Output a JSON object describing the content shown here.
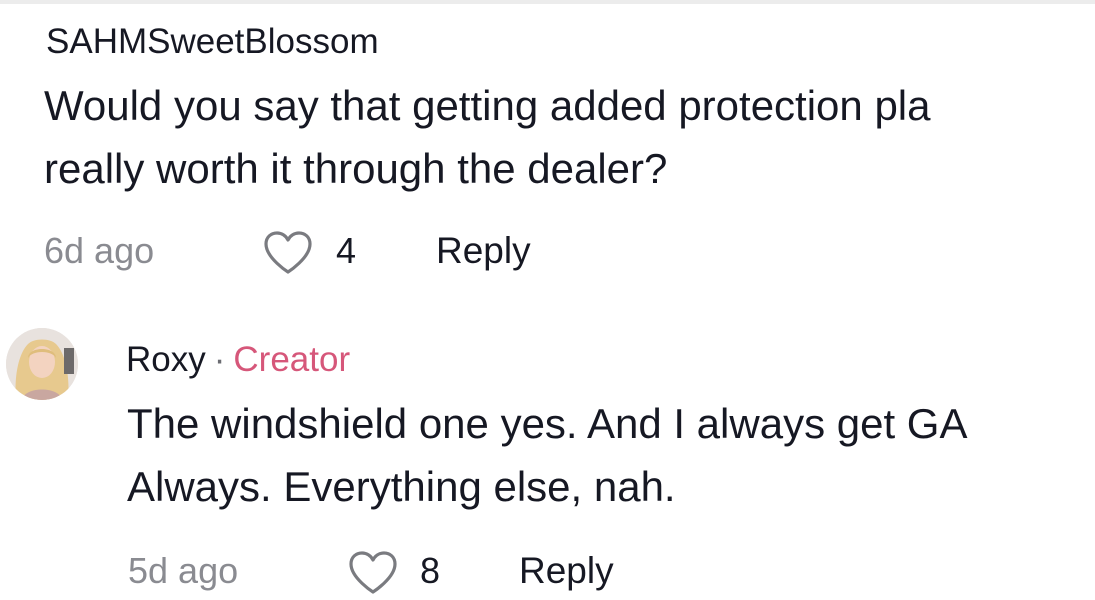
{
  "comments": [
    {
      "username": "SAHMSweetBlossom",
      "text_lines": [
        "Would you say that getting added protection pla",
        "really worth it through the dealer?"
      ],
      "time": "6d ago",
      "likes": "4",
      "reply_label": "Reply",
      "icons": {
        "like": "heart-outline-icon"
      }
    }
  ],
  "replies": [
    {
      "username": "Roxy",
      "separator": "·",
      "badge": "Creator",
      "text_lines": [
        "The windshield one yes. And I always get GA",
        "Always. Everything else, nah."
      ],
      "time": "5d ago",
      "likes": "8",
      "reply_label": "Reply",
      "icons": {
        "avatar": "user-avatar-photo",
        "like": "heart-outline-icon"
      }
    }
  ],
  "colors": {
    "text": "#161823",
    "secondary": "#8a8b91",
    "creator_badge": "#d6577a"
  }
}
